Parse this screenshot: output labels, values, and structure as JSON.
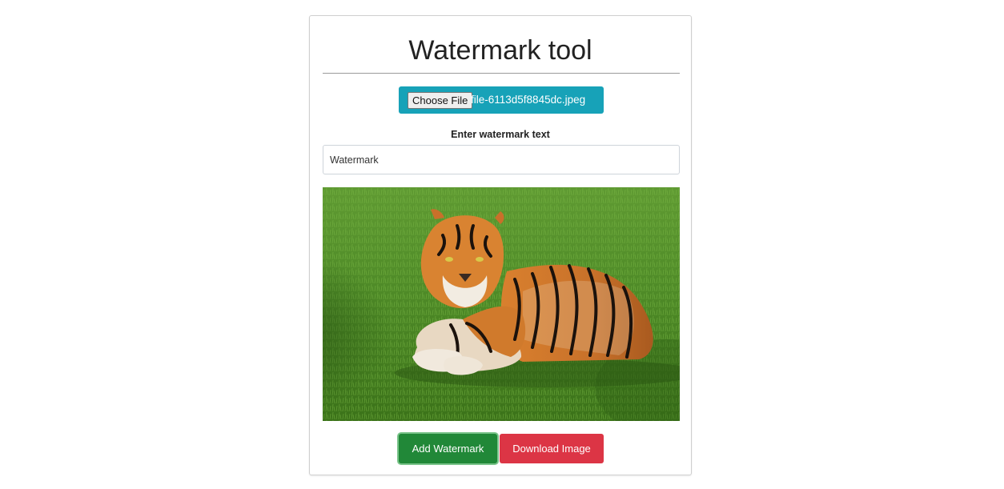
{
  "app": {
    "title": "Watermark tool"
  },
  "file_input": {
    "button_label": "Choose File",
    "file_name": "file-6113d5f8845dc.jpeg"
  },
  "watermark": {
    "label": "Enter watermark text",
    "value": "Watermark"
  },
  "image": {
    "subject": "tiger lying on grass"
  },
  "actions": {
    "add_label": "Add Watermark",
    "download_label": "Download Image"
  },
  "colors": {
    "file_picker_bg": "#17a2b8",
    "add_button_bg": "#218838",
    "download_button_bg": "#dc3545"
  }
}
